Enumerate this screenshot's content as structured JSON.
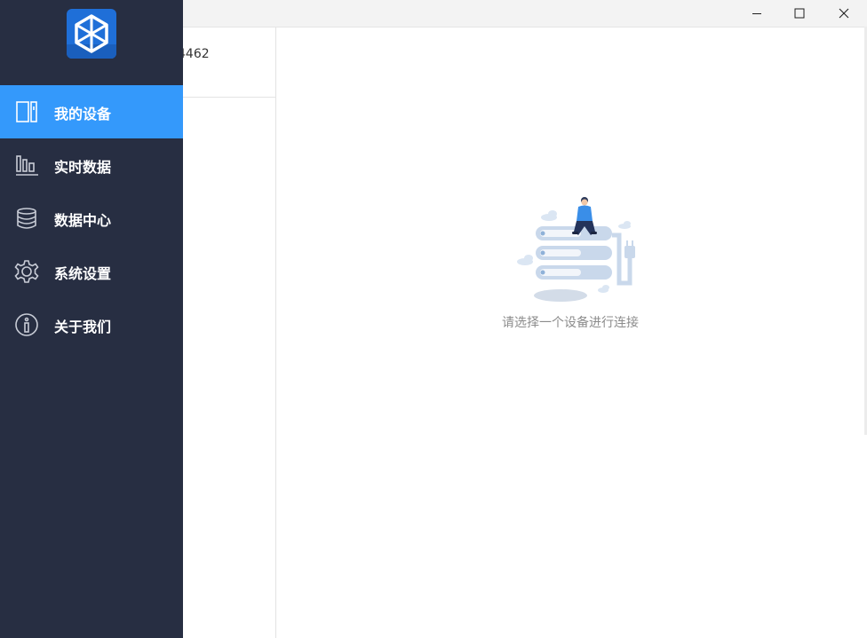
{
  "window": {
    "controls": [
      {
        "name": "minimize-button",
        "icon": "minimize-icon"
      },
      {
        "name": "maximize-button",
        "icon": "maximize-icon"
      },
      {
        "name": "close-button",
        "icon": "close-icon"
      }
    ]
  },
  "sidebar": {
    "logo_icon": "app-logo-icon",
    "items": [
      {
        "label": "我的设备",
        "icon": "device-icon",
        "active": true
      },
      {
        "label": "实时数据",
        "icon": "bar-chart-icon",
        "active": false
      },
      {
        "label": "数据中心",
        "icon": "database-icon",
        "active": false
      },
      {
        "label": "系统设置",
        "icon": "gear-icon",
        "active": false
      },
      {
        "label": "关于我们",
        "icon": "info-icon",
        "active": false
      }
    ]
  },
  "device_list": {
    "items": [
      {
        "id_text": "4462"
      }
    ]
  },
  "main": {
    "empty_state": {
      "illustration": "server-illustration",
      "message": "请选择一个设备进行连接"
    }
  },
  "colors": {
    "sidebar_bg": "#272e42",
    "active_item": "#3499fb",
    "empty_text": "#8c8c8c"
  }
}
